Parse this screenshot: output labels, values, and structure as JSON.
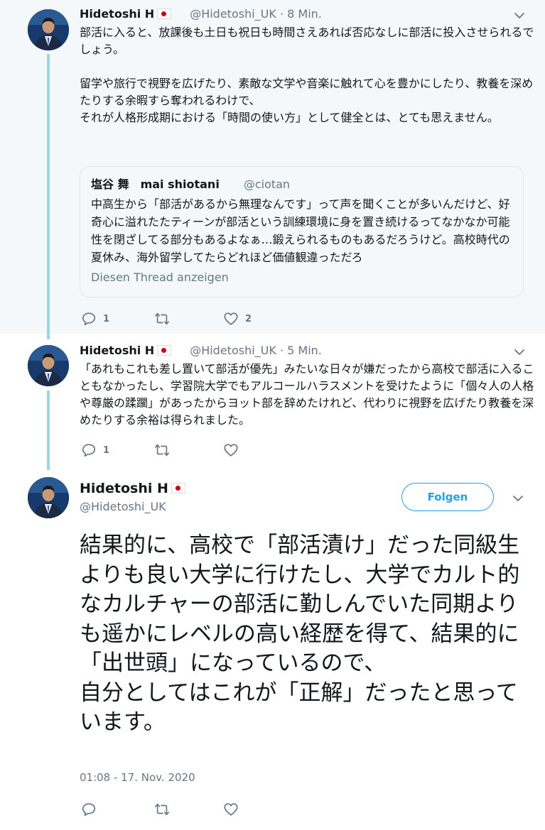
{
  "tweets": [
    {
      "name": "Hidetoshi H",
      "handle": "@Hidetoshi_UK",
      "time": "8 Min.",
      "text": "部活に入ると、放課後も土日も祝日も時間さえあれば否応なしに部活に投入させられるでしょう。\n\n留学や旅行で視野を広げたり、素敵な文学や音楽に触れて心を豊かにしたり、教養を深めたりする余暇すら奪われるわけで、\nそれが人格形成期における「時間の使い方」として健全とは、とても思えません。",
      "quote": {
        "name": "塩谷 舞　mai shiotani",
        "handle": "@ciotan",
        "text": "中高生から「部活があるから無理なんです」って声を聞くことが多いんだけど、好奇心に溢れたたティーンが部活という訓練環境に身を置き続けるってなかなか可能性を閉ざしてる部分もあるよなぁ…鍛えられるものもあるだろうけど。高校時代の夏休み、海外留学してたらどれほど価値観違っただろ",
        "link": "Diesen Thread anzeigen"
      },
      "replies": "1",
      "likes": "2"
    },
    {
      "name": "Hidetoshi H",
      "handle": "@Hidetoshi_UK",
      "time": "5 Min.",
      "text": "「あれもこれも差し置いて部活が優先」みたいな日々が嫌だったから高校で部活に入ることもなかったし、学習院大学でもアルコールハラスメントを受けたように「個々人の人格や尊厳の蹂躙」があったからヨット部を辞めたけれど、代わりに視野を広げたり教養を深めたりする余裕は得られました。",
      "replies": "1"
    },
    {
      "name": "Hidetoshi H",
      "handle": "@Hidetoshi_UK",
      "follow_label": "Folgen",
      "text": "結果的に、高校で「部活漬け」だった同級生よりも良い大学に行けたし、大学でカルト的なカルチャーの部活に勤しんでいた同期よりも遥かにレベルの高い経歴を得て、結果的に「出世頭」になっているので、\n自分としてはこれが「正解」だったと思っています。",
      "timestamp": "01:08 - 17. Nov. 2020"
    }
  ],
  "colors": {
    "accent": "#1da1f2",
    "muted": "#657786",
    "thread_line": "#9ad6e8",
    "flag_red": "#d0021b"
  },
  "icons": {
    "reply": "reply-icon",
    "retweet": "retweet-icon",
    "like": "heart-icon",
    "menu": "chevron-down-icon",
    "flag": "japan-flag-icon"
  }
}
